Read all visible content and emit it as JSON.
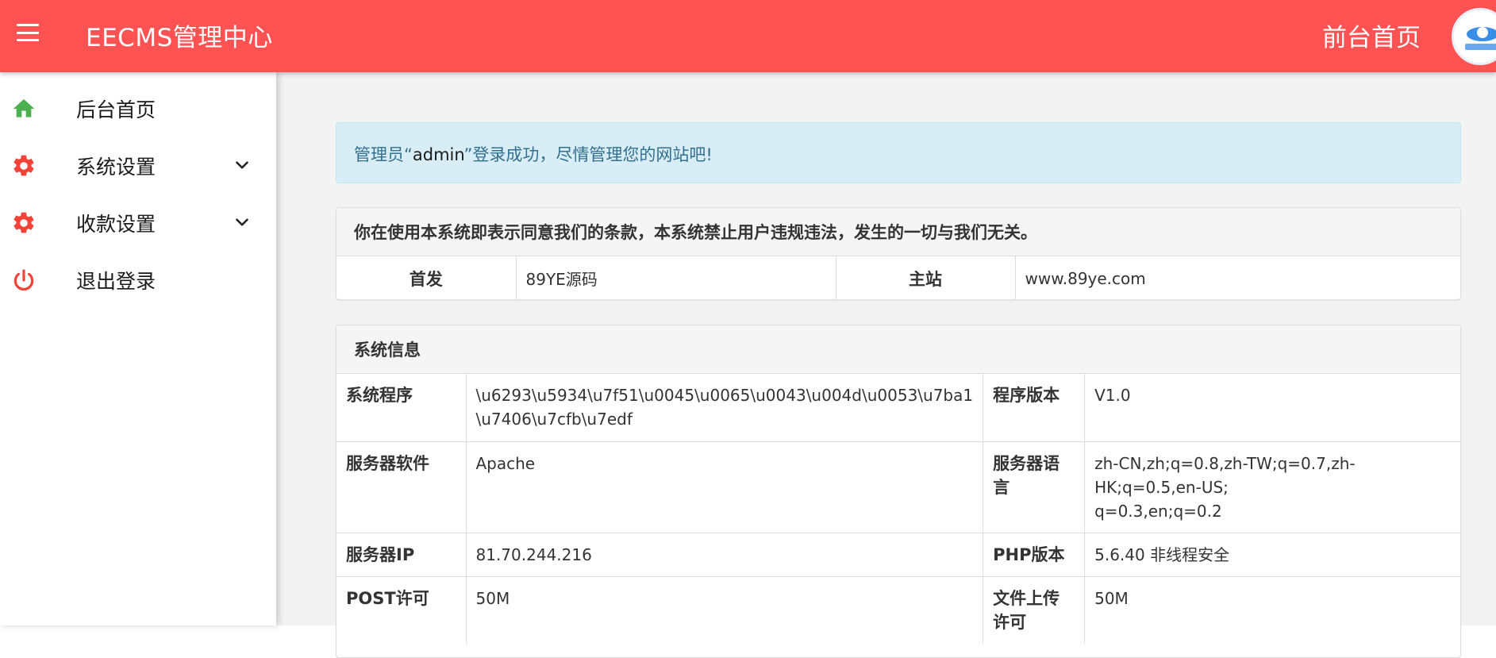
{
  "header": {
    "brand": "EECMS管理中心",
    "front_link": "前台首页"
  },
  "sidebar": {
    "items": [
      {
        "label": "后台首页",
        "icon": "home-icon",
        "color": "#4caf50",
        "has_caret": false
      },
      {
        "label": "系统设置",
        "icon": "gear-icon",
        "color": "#f44336",
        "has_caret": true
      },
      {
        "label": "收款设置",
        "icon": "gear-icon",
        "color": "#f44336",
        "has_caret": true
      },
      {
        "label": "退出登录",
        "icon": "power-icon",
        "color": "#f44336",
        "has_caret": false
      }
    ]
  },
  "alert": {
    "prefix": "管理员“",
    "username": "admin",
    "suffix": "”登录成功，尽情管理您的网站吧!"
  },
  "terms_panel": {
    "heading": "你在使用本系统即表示同意我们的条款，本系统禁止用户违规违法，发生的一切与我们无关。",
    "row": {
      "k1": "首发",
      "v1": "89YE源码",
      "k2": "主站",
      "v2": "www.89ye.com"
    }
  },
  "sysinfo_panel": {
    "heading": "系统信息",
    "rows": [
      {
        "k1": "系统程序",
        "v1": "\\u6293\\u5934\\u7f51\\u0045\\u0065\\u0043\\u004d\\u0053\\u7ba1\n\\u7406\\u7cfb\\u7edf",
        "k2": "程序版本",
        "v2": "V1.0"
      },
      {
        "k1": "服务器软件",
        "v1": "Apache",
        "k2": "服务器语\n言",
        "v2": "zh-CN,zh;q=0.8,zh-TW;q=0.7,zh-HK;q=0.5,en-US;\nq=0.3,en;q=0.2"
      },
      {
        "k1": "服务器IP",
        "v1": "81.70.244.216",
        "k2": "PHP版本",
        "v2": "5.6.40 非线程安全"
      },
      {
        "k1": "POST许可",
        "v1": "50M",
        "k2": "文件上传\n许可",
        "v2": "50M"
      }
    ]
  },
  "colors": {
    "header_bg": "#ff5252",
    "alert_bg": "#d9edf7",
    "alert_text": "#31708f"
  }
}
